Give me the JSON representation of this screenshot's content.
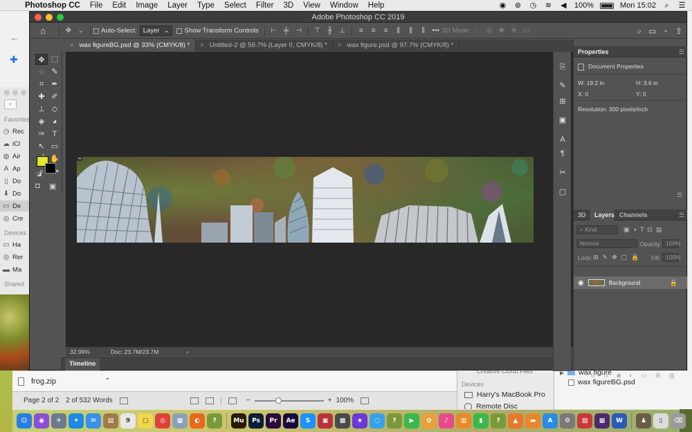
{
  "menubar": {
    "app": "Photoshop CC",
    "items": [
      "File",
      "Edit",
      "Image",
      "Layer",
      "Type",
      "Select",
      "Filter",
      "3D",
      "View",
      "Window",
      "Help"
    ],
    "battery": "100%",
    "clock": "Mon 15:02"
  },
  "ps": {
    "window_title": "Adobe Photoshop CC 2019",
    "options": {
      "auto_select_label": "Auto-Select:",
      "auto_select_target": "Layer",
      "show_transform_label": "Show Transform Controls",
      "mode_3d_label": "3D Mode:"
    },
    "tabs": [
      {
        "label": "wax figureBG.psd @ 33% (CMYK/8) *",
        "active": true
      },
      {
        "label": "Untitled-2 @ 58.7% (Layer 0, CMYK/8) *",
        "active": false
      },
      {
        "label": "wax figure.psd @ 97.7% (CMYK/8) *",
        "active": false
      }
    ],
    "colors": {
      "foreground": "#dfe82b",
      "background": "#000000"
    },
    "status": {
      "zoom": "32.99%",
      "doc": "Doc: 23.7M/23.7M"
    },
    "timeline_label": "Timeline",
    "properties": {
      "title": "Properties",
      "subtitle": "Document Properties",
      "w": "W:  19.2 in",
      "h": "H:  3.6 in",
      "x": "X:  0",
      "y": "Y:  0",
      "resolution": "Resolution: 300 pixels/inch"
    },
    "layers": {
      "tab_3d": "3D",
      "tab_layers": "Layers",
      "tab_channels": "Channels",
      "kind_placeholder": "Kind",
      "blend_mode": "Normal",
      "opacity_label": "Opacity:",
      "opacity_value": "100%",
      "lock_label": "Lock:",
      "fill_label": "Fill:",
      "fill_value": "100%",
      "items": [
        {
          "name": "Background",
          "visible": true,
          "locked": true
        }
      ]
    }
  },
  "finder_sidebar": {
    "favorites_label": "Favorites",
    "items": [
      "Rec",
      "iCl",
      "Air",
      "Ap",
      "Do",
      "Do",
      "De",
      "Cre"
    ],
    "devices_label": "Devices",
    "device_items": [
      "Ha",
      "Rer",
      "Ma"
    ],
    "shared_label": "Shared"
  },
  "downloads": {
    "file": "frog.zip"
  },
  "word_status": {
    "page": "Page 2 of 2",
    "words": "2 of 532 Words",
    "zoom": "100%"
  },
  "finder_devices": {
    "cut_label": "Creative Cloud Files",
    "label": "Devices",
    "items": [
      "Harry's MacBook Pro",
      "Remote Disc"
    ]
  },
  "finder_files": {
    "folder": "wax figure",
    "file": "wax figureBG.psd"
  },
  "dock": {
    "apps": [
      {
        "name": "finder",
        "glyph": "☺",
        "color": "#2a7de1"
      },
      {
        "name": "siri",
        "glyph": "◉",
        "color": "#8a4fd8"
      },
      {
        "name": "launchpad",
        "glyph": "✈",
        "color": "#6c7a8a"
      },
      {
        "name": "safari",
        "glyph": "✦",
        "color": "#1e88e5"
      },
      {
        "name": "mail",
        "glyph": "✉",
        "color": "#3b8fe6"
      },
      {
        "name": "notes",
        "glyph": "▤",
        "color": "#a17a4a"
      },
      {
        "name": "calendar",
        "glyph": "9",
        "color": "#e8e8e8"
      },
      {
        "name": "stickies",
        "glyph": "▢",
        "color": "#f0d84a"
      },
      {
        "name": "chrome",
        "glyph": "◎",
        "color": "#db4437"
      },
      {
        "name": "preview",
        "glyph": "▦",
        "color": "#8aa0b8"
      },
      {
        "name": "firefox",
        "glyph": "◐",
        "color": "#e66a1a"
      },
      {
        "name": "help",
        "glyph": "?",
        "color": "#7a9a3a"
      },
      {
        "name": "muse",
        "glyph": "Mu",
        "color": "#2a1a0a"
      },
      {
        "name": "photoshop",
        "glyph": "Ps",
        "color": "#0a1e3c"
      },
      {
        "name": "premiere",
        "glyph": "Pr",
        "color": "#2a0a3c"
      },
      {
        "name": "after-effects",
        "glyph": "Ae",
        "color": "#1a0a3c"
      },
      {
        "name": "skype",
        "glyph": "S",
        "color": "#1e90ff"
      },
      {
        "name": "photo-booth",
        "glyph": "▣",
        "color": "#b8323a"
      },
      {
        "name": "image-capture",
        "glyph": "▩",
        "color": "#4a4a4a"
      },
      {
        "name": "imovie",
        "glyph": "★",
        "color": "#6a3ad8"
      },
      {
        "name": "messages",
        "glyph": "◌",
        "color": "#3aa0e8"
      },
      {
        "name": "help2",
        "glyph": "?",
        "color": "#7a9a3a"
      },
      {
        "name": "facetime",
        "glyph": "▶",
        "color": "#3ab84a"
      },
      {
        "name": "photos",
        "glyph": "✿",
        "color": "#e8a03a"
      },
      {
        "name": "itunes",
        "glyph": "♪",
        "color": "#e84a8a"
      },
      {
        "name": "books",
        "glyph": "▥",
        "color": "#e88a2a"
      },
      {
        "name": "numbers",
        "glyph": "▮",
        "color": "#3ab84a"
      },
      {
        "name": "help3",
        "glyph": "?",
        "color": "#7a9a3a"
      },
      {
        "name": "vlc",
        "glyph": "▲",
        "color": "#e8782a"
      },
      {
        "name": "ibooks",
        "glyph": "▬",
        "color": "#e8882a"
      },
      {
        "name": "app-store",
        "glyph": "A",
        "color": "#2a8ae8"
      },
      {
        "name": "system-preferences",
        "glyph": "⚙",
        "color": "#7a7a7a"
      },
      {
        "name": "flashcards",
        "glyph": "▧",
        "color": "#c83a3a"
      },
      {
        "name": "screenflow",
        "glyph": "▦",
        "color": "#4a2a6a"
      },
      {
        "name": "word",
        "glyph": "W",
        "color": "#2a5ab8"
      },
      {
        "name": "person-photo",
        "glyph": "♟",
        "color": "#6a5a4a"
      },
      {
        "name": "document",
        "glyph": "▯",
        "color": "#dcdcdc"
      },
      {
        "name": "trash",
        "glyph": "⌫",
        "color": "#9a9a9a"
      }
    ]
  }
}
